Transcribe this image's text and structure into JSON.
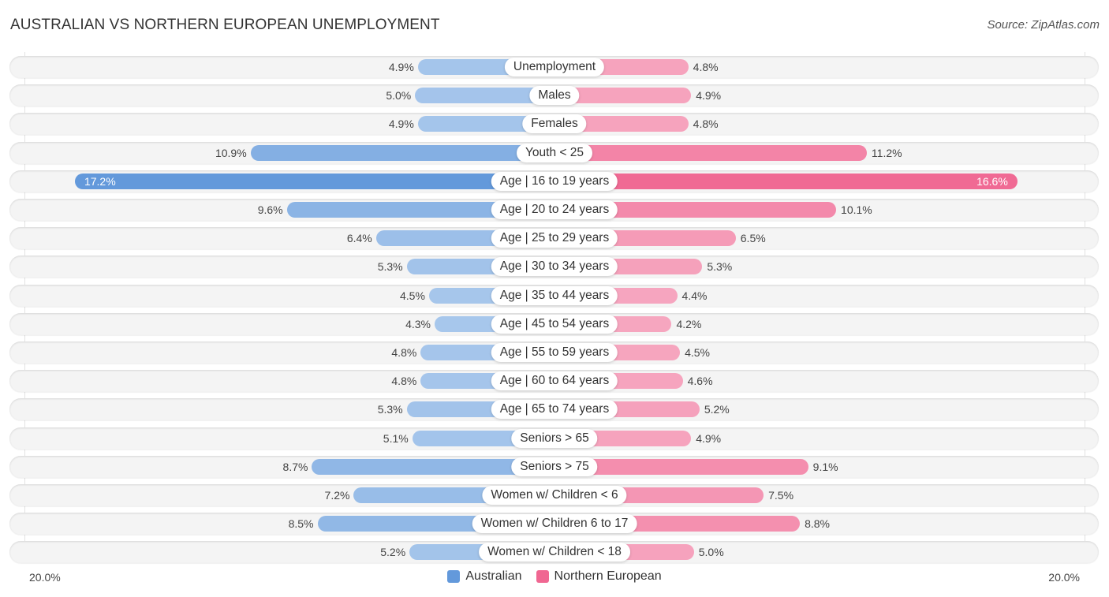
{
  "header": {
    "title": "AUSTRALIAN VS NORTHERN EUROPEAN UNEMPLOYMENT",
    "source": "Source: ZipAtlas.com"
  },
  "colors": {
    "australian_strong": "#6399db",
    "australian_light": "#a9c8ec",
    "northern_strong": "#f06792",
    "northern_light": "#f6a7c0"
  },
  "chart_data": {
    "type": "bar",
    "orientation": "horizontal-diverging",
    "title": "AUSTRALIAN VS NORTHERN EUROPEAN UNEMPLOYMENT",
    "xlabel": "",
    "ylabel": "",
    "xlim": [
      -20,
      20
    ],
    "axis_labels": {
      "left": "20.0%",
      "right": "20.0%"
    },
    "legend_position": "bottom-center",
    "categories": [
      "Unemployment",
      "Males",
      "Females",
      "Youth < 25",
      "Age | 16 to 19 years",
      "Age | 20 to 24 years",
      "Age | 25 to 29 years",
      "Age | 30 to 34 years",
      "Age | 35 to 44 years",
      "Age | 45 to 54 years",
      "Age | 55 to 59 years",
      "Age | 60 to 64 years",
      "Age | 65 to 74 years",
      "Seniors > 65",
      "Seniors > 75",
      "Women w/ Children < 6",
      "Women w/ Children 6 to 17",
      "Women w/ Children < 18"
    ],
    "series": [
      {
        "name": "Australian",
        "side": "left",
        "values": [
          4.9,
          5.0,
          4.9,
          10.9,
          17.2,
          9.6,
          6.4,
          5.3,
          4.5,
          4.3,
          4.8,
          4.8,
          5.3,
          5.1,
          8.7,
          7.2,
          8.5,
          5.2
        ],
        "labels": [
          "4.9%",
          "5.0%",
          "4.9%",
          "10.9%",
          "17.2%",
          "9.6%",
          "6.4%",
          "5.3%",
          "4.5%",
          "4.3%",
          "4.8%",
          "4.8%",
          "5.3%",
          "5.1%",
          "8.7%",
          "7.2%",
          "8.5%",
          "5.2%"
        ]
      },
      {
        "name": "Northern European",
        "side": "right",
        "values": [
          4.8,
          4.9,
          4.8,
          11.2,
          16.6,
          10.1,
          6.5,
          5.3,
          4.4,
          4.2,
          4.5,
          4.6,
          5.2,
          4.9,
          9.1,
          7.5,
          8.8,
          5.0
        ],
        "labels": [
          "4.8%",
          "4.9%",
          "4.8%",
          "11.2%",
          "16.6%",
          "10.1%",
          "6.5%",
          "5.3%",
          "4.4%",
          "4.2%",
          "4.5%",
          "4.6%",
          "5.2%",
          "4.9%",
          "9.1%",
          "7.5%",
          "8.8%",
          "5.0%"
        ]
      }
    ]
  },
  "legend": {
    "items": [
      {
        "label": "Australian"
      },
      {
        "label": "Northern European"
      }
    ]
  }
}
